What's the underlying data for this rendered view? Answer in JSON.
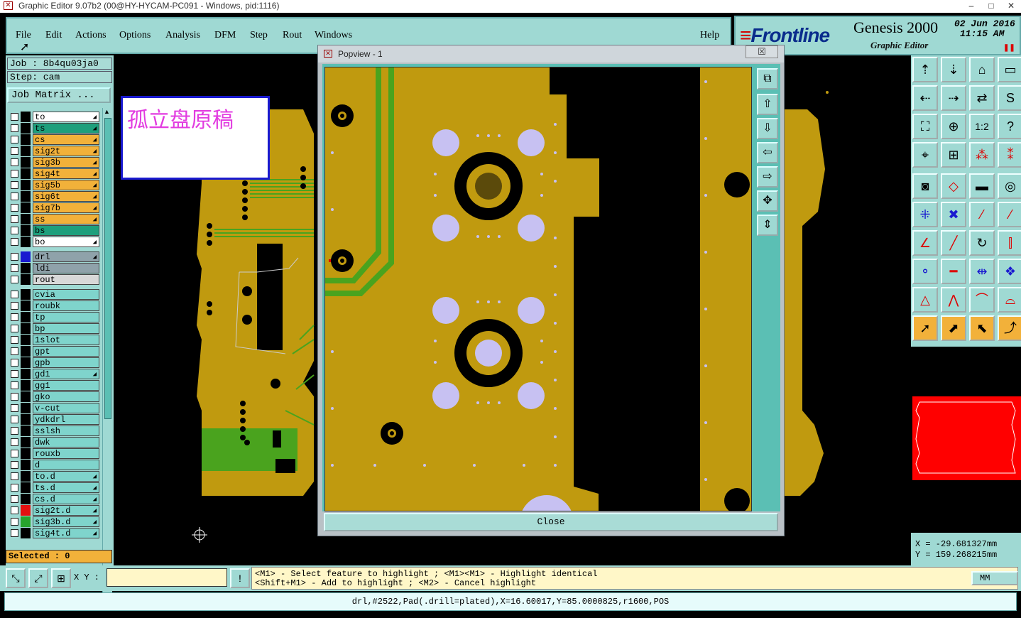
{
  "window": {
    "title": "Graphic Editor 9.07b2 (00@HY-HYCAM-PC091 - Windows, pid:1116)",
    "controls": [
      "–",
      "□",
      "✕"
    ]
  },
  "menu": {
    "items": [
      "File",
      "Edit",
      "Actions",
      "Options",
      "Analysis",
      "DFM",
      "Step",
      "Rout",
      "Windows"
    ],
    "help": "Help"
  },
  "brand": {
    "logo": "Frontline",
    "product": "Genesis 2000",
    "subtitle": "Graphic Editor",
    "date": "02 Jun 2016",
    "time": "11:15 AM"
  },
  "job": {
    "job_label": "Job : 8b4qu03ja0",
    "step_label": "Step: cam",
    "matrix_button": "Job Matrix ..."
  },
  "layers": [
    {
      "name": "to",
      "color": "#ffffff",
      "swatch": "#000000",
      "arrow": true
    },
    {
      "name": "ts",
      "color": "#1e9f7c",
      "swatch": "#000000",
      "arrow": true
    },
    {
      "name": "cs",
      "color": "#f2b13a",
      "swatch": "#000000",
      "arrow": true
    },
    {
      "name": "sig2t",
      "color": "#f2b13a",
      "swatch": "#000000",
      "arrow": true
    },
    {
      "name": "sig3b",
      "color": "#f2b13a",
      "swatch": "#000000",
      "arrow": true
    },
    {
      "name": "sig4t",
      "color": "#f2b13a",
      "swatch": "#000000",
      "arrow": true
    },
    {
      "name": "sig5b",
      "color": "#f2b13a",
      "swatch": "#000000",
      "arrow": true
    },
    {
      "name": "sig6t",
      "color": "#f2b13a",
      "swatch": "#000000",
      "arrow": true
    },
    {
      "name": "sig7b",
      "color": "#f2b13a",
      "swatch": "#000000",
      "arrow": true
    },
    {
      "name": "ss",
      "color": "#f2b13a",
      "swatch": "#000000",
      "arrow": true
    },
    {
      "name": "bs",
      "color": "#1e9f7c",
      "swatch": "#000000",
      "arrow": false
    },
    {
      "name": "bo",
      "color": "#ffffff",
      "swatch": "#000000",
      "arrow": true
    },
    {
      "name": "drl",
      "color": "#8fa2aa",
      "swatch": "#1a1ad0",
      "arrow": true
    },
    {
      "name": "ldi",
      "color": "#8fa2aa",
      "swatch": "#000000",
      "arrow": false
    },
    {
      "name": "rout",
      "color": "#d8d8d8",
      "swatch": "#000000",
      "arrow": false
    },
    {
      "name": "cvia",
      "color": "#7fd4cc",
      "swatch": "#000000",
      "arrow": false
    },
    {
      "name": "roubk",
      "color": "#7fd4cc",
      "swatch": "#000000",
      "arrow": false
    },
    {
      "name": "tp",
      "color": "#7fd4cc",
      "swatch": "#000000",
      "arrow": false
    },
    {
      "name": "bp",
      "color": "#7fd4cc",
      "swatch": "#000000",
      "arrow": false
    },
    {
      "name": "1slot",
      "color": "#7fd4cc",
      "swatch": "#000000",
      "arrow": false
    },
    {
      "name": "gpt",
      "color": "#7fd4cc",
      "swatch": "#000000",
      "arrow": false
    },
    {
      "name": "gpb",
      "color": "#7fd4cc",
      "swatch": "#000000",
      "arrow": false
    },
    {
      "name": "gd1",
      "color": "#7fd4cc",
      "swatch": "#000000",
      "arrow": true
    },
    {
      "name": "gg1",
      "color": "#7fd4cc",
      "swatch": "#000000",
      "arrow": false
    },
    {
      "name": "gko",
      "color": "#7fd4cc",
      "swatch": "#000000",
      "arrow": false
    },
    {
      "name": "v-cut",
      "color": "#7fd4cc",
      "swatch": "#000000",
      "arrow": false
    },
    {
      "name": "ydkdrl",
      "color": "#7fd4cc",
      "swatch": "#000000",
      "arrow": false
    },
    {
      "name": "sslsh",
      "color": "#7fd4cc",
      "swatch": "#000000",
      "arrow": false
    },
    {
      "name": "dwk",
      "color": "#7fd4cc",
      "swatch": "#000000",
      "arrow": false
    },
    {
      "name": "rouxb",
      "color": "#7fd4cc",
      "swatch": "#000000",
      "arrow": false
    },
    {
      "name": "d",
      "color": "#7fd4cc",
      "swatch": "#000000",
      "arrow": false
    },
    {
      "name": "to.d",
      "color": "#7fd4cc",
      "swatch": "#000000",
      "arrow": true
    },
    {
      "name": "ts.d",
      "color": "#7fd4cc",
      "swatch": "#000000",
      "arrow": true
    },
    {
      "name": "cs.d",
      "color": "#7fd4cc",
      "swatch": "#000000",
      "arrow": true
    },
    {
      "name": "sig2t.d",
      "color": "#7fd4cc",
      "swatch": "#e31010",
      "arrow": true
    },
    {
      "name": "sig3b.d",
      "color": "#7fd4cc",
      "swatch": "#27a32d",
      "arrow": true
    },
    {
      "name": "sig4t.d",
      "color": "#7fd4cc",
      "swatch": "#000000",
      "arrow": true
    }
  ],
  "selected_label": "Selected : 0",
  "annotation": "孤立盘原稿",
  "popview": {
    "title": "Popview - 1",
    "close_x": "☒",
    "close_button": "Close"
  },
  "coords": {
    "x": "X = -29.681327mm",
    "y": "Y = 159.268215mm"
  },
  "bottom": {
    "xy_label": "X Y :",
    "xy_value": "",
    "message_line1": "<M1> - Select feature to highlight ; <M1><M1> - Highlight identical",
    "message_line2": "<Shift+M1> - Add to highlight ; <M2> - Cancel highlight",
    "units": "MM",
    "status": "drl,#2522,Pad(.drill=plated),X=16.60017,Y=85.0000825,r1600,POS"
  },
  "colors": {
    "panel": "#9fd9d3",
    "copper": "#c09a0f",
    "trace": "#4aa31e",
    "drill": "#c7c1f2",
    "highlight": "#1a1ad0"
  }
}
